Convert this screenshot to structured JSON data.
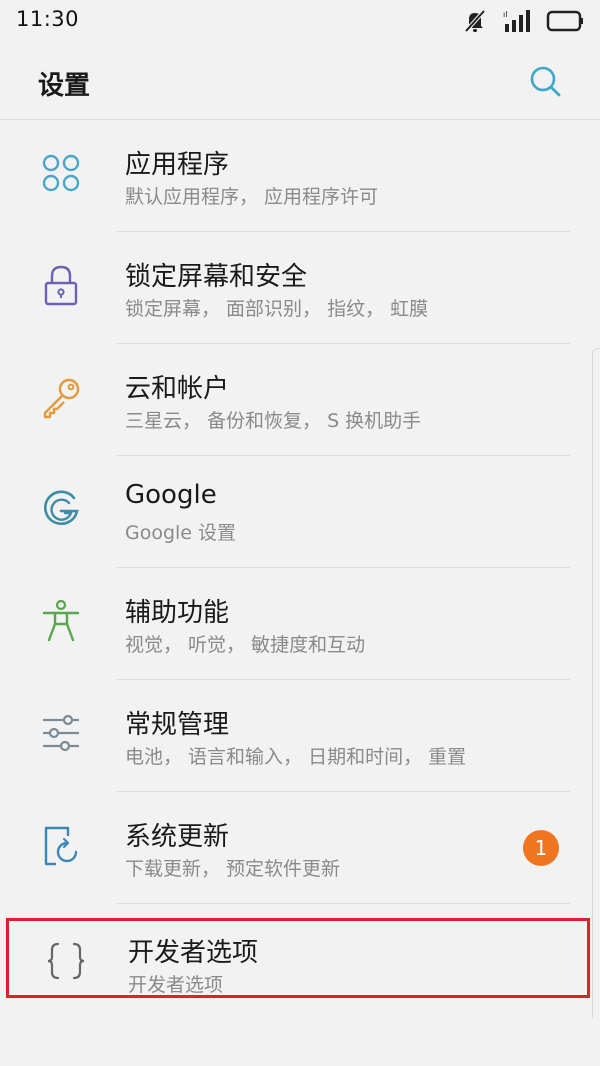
{
  "status_bar": {
    "time": "11:30",
    "icons": [
      "mute-icon",
      "signal-icon",
      "battery-icon"
    ]
  },
  "header": {
    "title": "设置",
    "search_icon": "search-icon"
  },
  "items": [
    {
      "title": "应用程序",
      "subtitle": "默认应用程序， 应用程序许可",
      "icon": "apps-icon",
      "color": "#4aa6c8"
    },
    {
      "title": "锁定屏幕和安全",
      "subtitle": "锁定屏幕， 面部识别， 指纹， 虹膜",
      "icon": "lock-icon",
      "color": "#6b62b6"
    },
    {
      "title": "云和帐户",
      "subtitle": "三星云， 备份和恢复， S 换机助手",
      "icon": "key-icon",
      "color": "#e29a3e"
    },
    {
      "title": "Google",
      "subtitle": "Google 设置",
      "icon": "google-icon",
      "color": "#3f8ca6"
    },
    {
      "title": "辅助功能",
      "subtitle": "视觉， 听觉， 敏捷度和互动",
      "icon": "accessibility-icon",
      "color": "#5aa64f"
    },
    {
      "title": "常规管理",
      "subtitle": "电池， 语言和输入， 日期和时间， 重置",
      "icon": "sliders-icon",
      "color": "#7d8a94"
    },
    {
      "title": "系统更新",
      "subtitle": "下载更新， 预定软件更新",
      "icon": "update-icon",
      "color": "#3c86b9",
      "badge": "1"
    },
    {
      "title": "开发者选项",
      "subtitle": "开发者选项",
      "icon": "braces-icon",
      "color": "#666666"
    }
  ],
  "colors": {
    "background": "#f2f2f2",
    "badge": "#f07521",
    "highlight_border": "#d9232a",
    "search_icon": "#3fa6c9"
  }
}
